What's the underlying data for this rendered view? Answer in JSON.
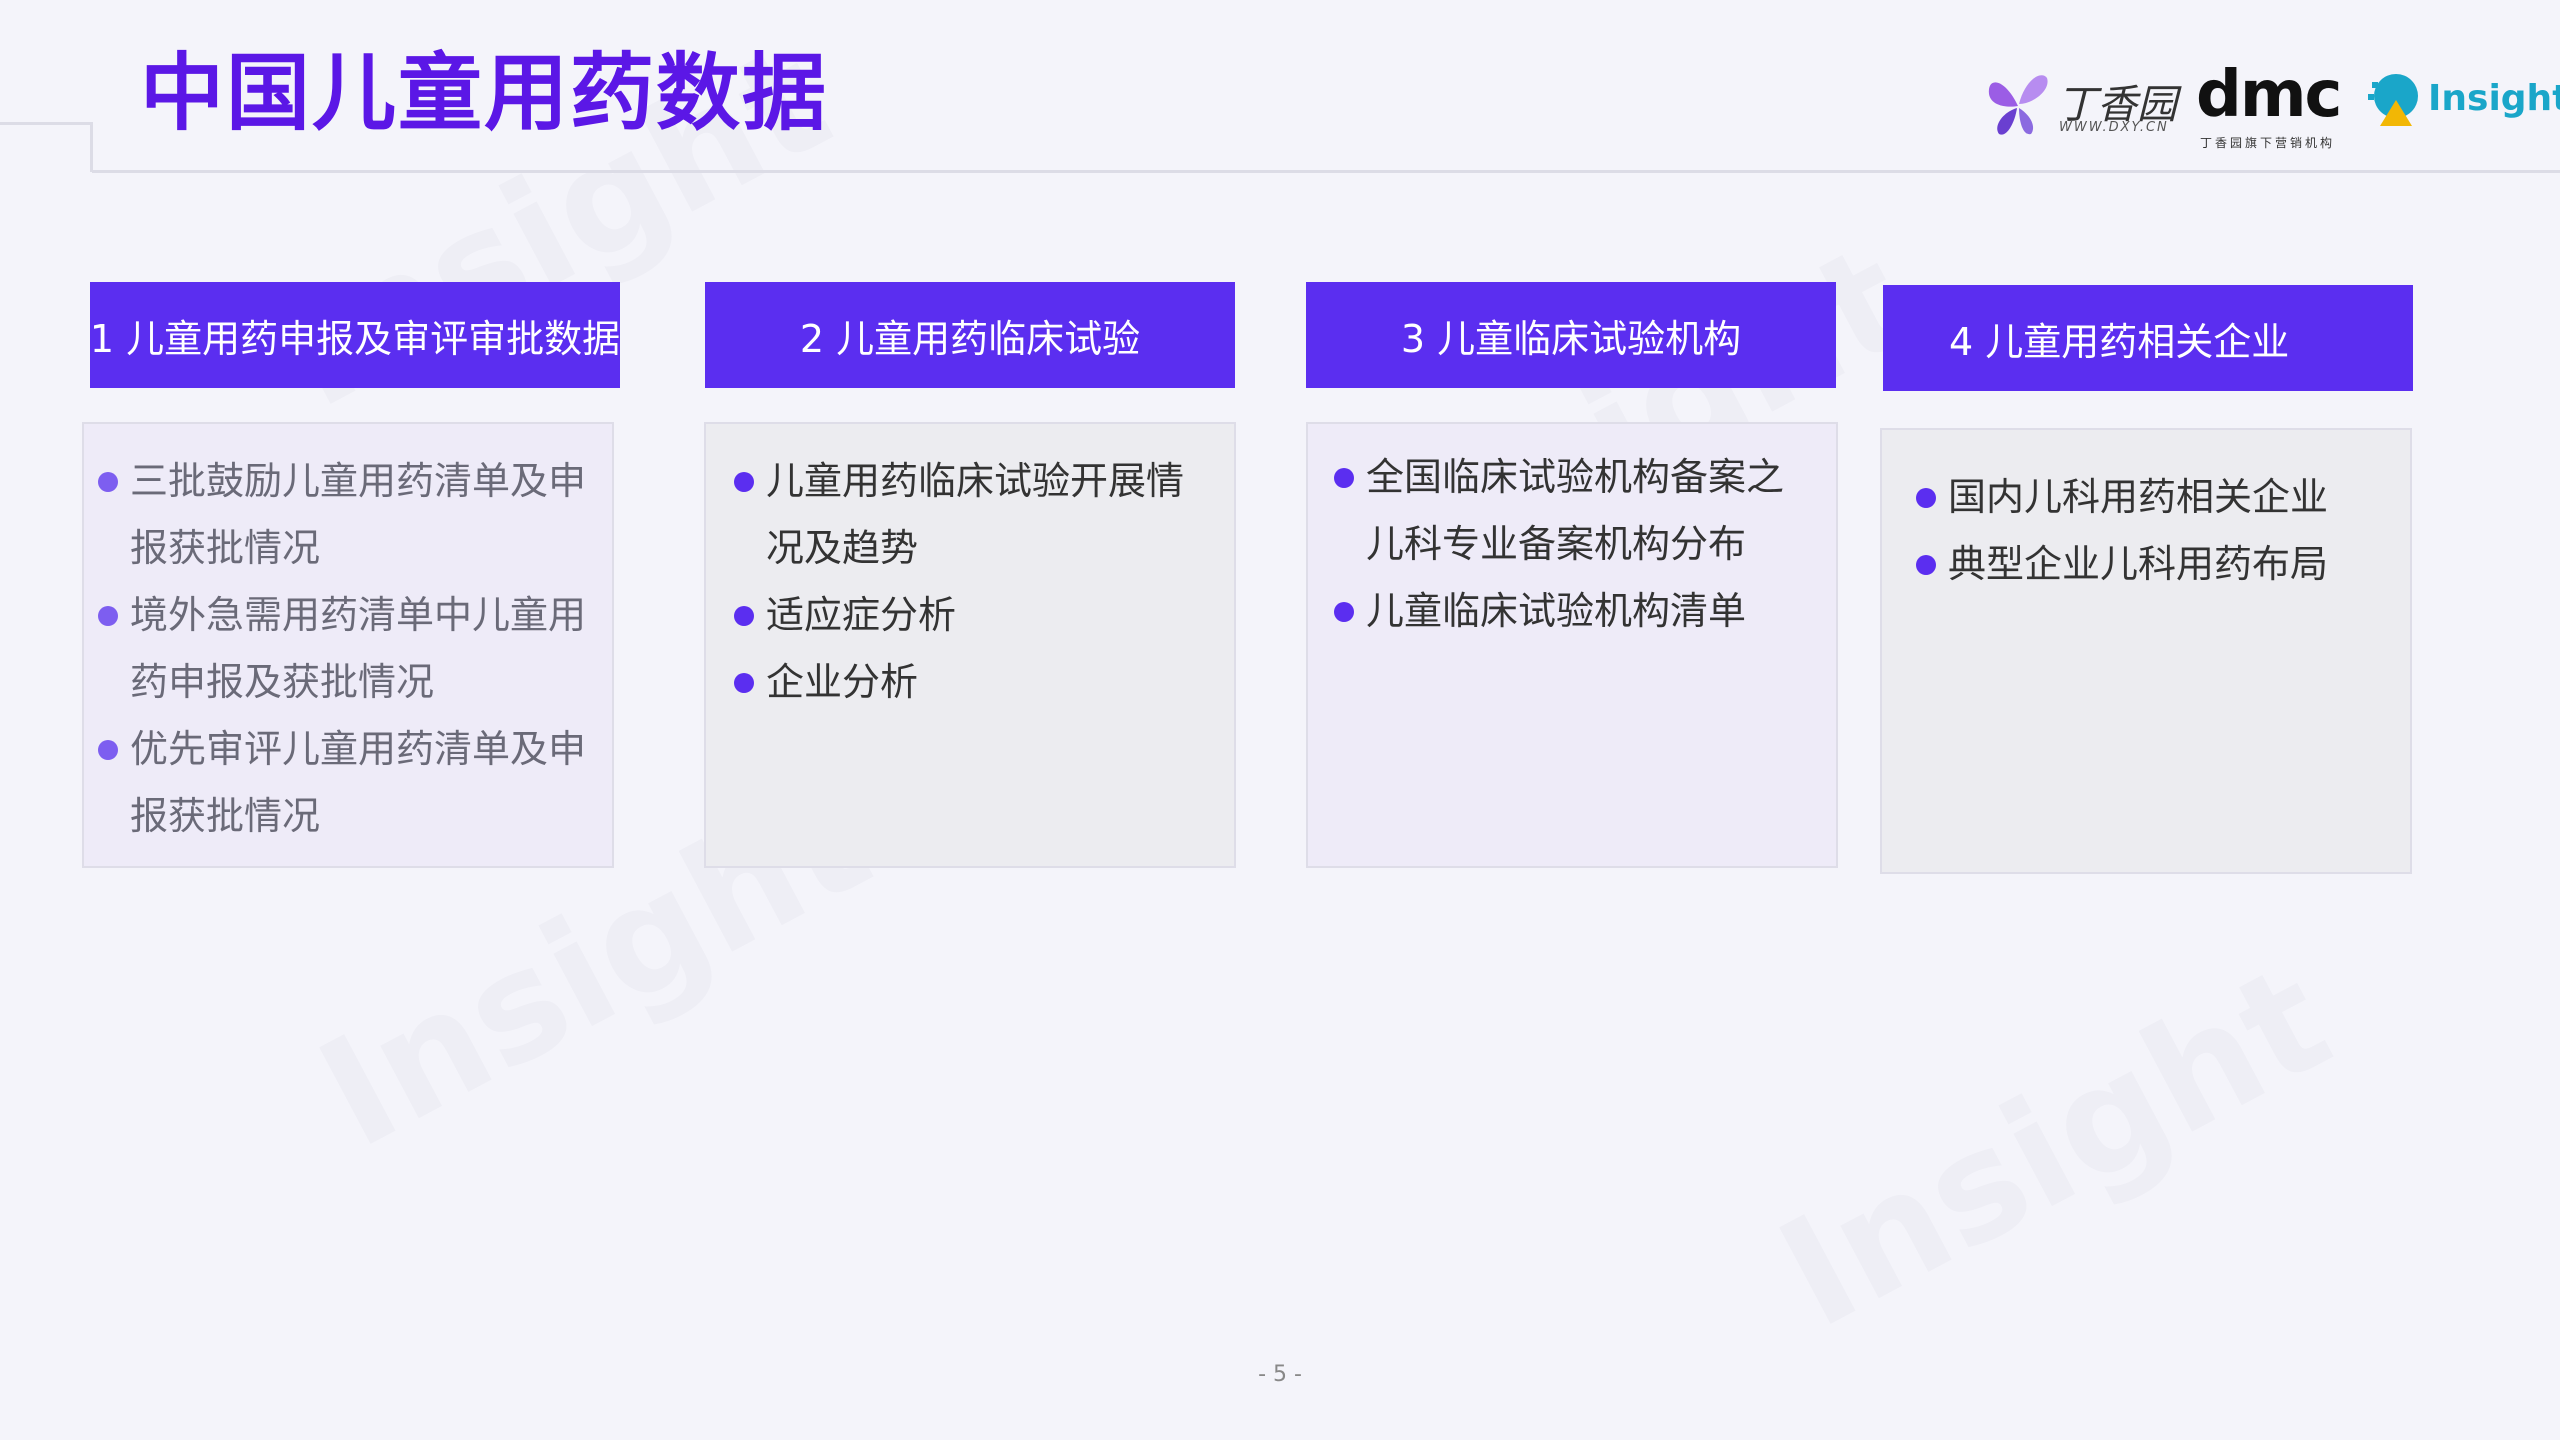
{
  "title": "中国儿童用药数据",
  "logos": {
    "dxy_name": "丁香园",
    "dxy_url": "WWW.DXY.CN",
    "dmc_name": "dmc",
    "dmc_sub": "丁香园旗下营销机构",
    "insight_name": "Insight"
  },
  "watermark": "Insight",
  "columns": [
    {
      "header": "1 儿童用药申报及审评审批数据",
      "items": [
        "三批鼓励儿童用药清单及申报获批情况",
        "境外急需用药清单中儿童用药申报及获批情况",
        "优先审评儿童用药清单及申报获批情况"
      ]
    },
    {
      "header": "2 儿童用药临床试验",
      "items": [
        "儿童用药临床试验开展情况及趋势",
        "适应症分析",
        "企业分析"
      ]
    },
    {
      "header": "3 儿童临床试验机构",
      "items": [
        "全国临床试验机构备案之儿科专业备案机构分布",
        "儿童临床试验机构清单"
      ]
    },
    {
      "header": "4 儿童用药相关企业",
      "items": [
        "国内儿科用药相关企业",
        "典型企业儿科用药布局"
      ]
    }
  ],
  "page_number": "- 5 -",
  "colors": {
    "accent": "#5b2ef0",
    "title": "#5b17e6",
    "background": "#f4f4fa"
  }
}
